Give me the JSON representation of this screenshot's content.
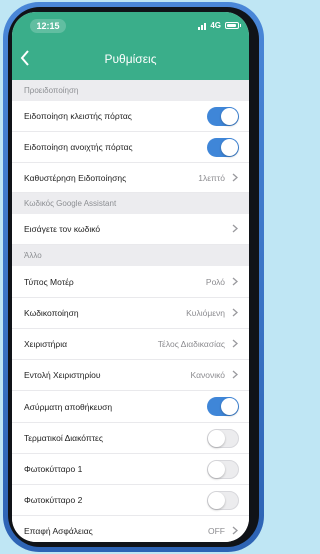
{
  "status_bar": {
    "time": "12:15",
    "network": "4G"
  },
  "header": {
    "title": "Ρυθμίσεις"
  },
  "sections": [
    {
      "title": "Προειδοποίηση",
      "rows": [
        {
          "label": "Ειδοποίηση κλειστής πόρτας",
          "type": "toggle",
          "on": true
        },
        {
          "label": "Ειδοποίηση ανοιχτής πόρτας",
          "type": "toggle",
          "on": true
        },
        {
          "label": "Καθυστέρηση Ειδοποίησης",
          "type": "link",
          "value": "1λεπτό"
        }
      ]
    },
    {
      "title": "Κωδικός Google Assistant",
      "rows": [
        {
          "label": "Εισάγετε τον κωδικό",
          "type": "link",
          "value": ""
        }
      ]
    },
    {
      "title": "Άλλο",
      "rows": [
        {
          "label": "Τύπος Μοτέρ",
          "type": "link",
          "value": "Ρολό"
        },
        {
          "label": "Κωδικοποίηση",
          "type": "link",
          "value": "Κυλιόμενη"
        },
        {
          "label": "Χειριστήρια",
          "type": "link",
          "value": "Τέλος Διαδικασίας"
        },
        {
          "label": "Εντολή Χειριστηρίου",
          "type": "link",
          "value": "Κανονικό"
        },
        {
          "label": "Ασύρματη αποθήκευση",
          "type": "toggle",
          "on": true
        },
        {
          "label": "Τερματικοί Διακόπτες",
          "type": "toggle",
          "on": false
        },
        {
          "label": "Φωτοκύτταρο 1",
          "type": "toggle",
          "on": false
        },
        {
          "label": "Φωτοκύτταρο 2",
          "type": "toggle",
          "on": false
        },
        {
          "label": "Επαφή Ασφάλειας",
          "type": "link",
          "value": "OFF"
        }
      ]
    }
  ],
  "colors": {
    "accent": "#3aae8a",
    "toggle_on": "#3f86d8"
  }
}
